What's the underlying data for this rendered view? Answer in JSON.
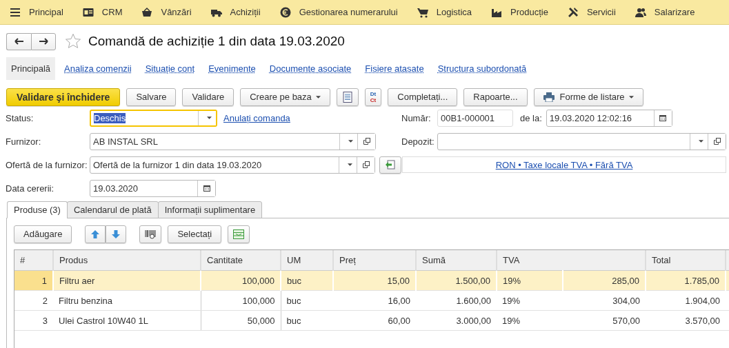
{
  "menu": [
    {
      "kind": "menu",
      "label": "Principal"
    },
    {
      "kind": "crm",
      "label": "CRM"
    },
    {
      "kind": "sales",
      "label": "Vânzări"
    },
    {
      "kind": "purchases",
      "label": "Achiziții"
    },
    {
      "kind": "money",
      "label": "Gestionarea numerarului"
    },
    {
      "kind": "logistics",
      "label": "Logistica"
    },
    {
      "kind": "production",
      "label": "Producție"
    },
    {
      "kind": "services",
      "label": "Servicii"
    },
    {
      "kind": "payroll",
      "label": "Salarizare"
    }
  ],
  "title": "Comandă de achiziție 1 din data 19.03.2020",
  "nav": [
    {
      "label": "Principală",
      "selected": true
    },
    {
      "label": "Analiza comenzii",
      "selected": false
    },
    {
      "label": "Situație cont",
      "selected": false
    },
    {
      "label": "Evenimente",
      "selected": false
    },
    {
      "label": "Documente asociate",
      "selected": false
    },
    {
      "label": "Fisiere atasate",
      "selected": false
    },
    {
      "label": "Structura subordonată",
      "selected": false
    }
  ],
  "toolbar": [
    {
      "kind": "primary",
      "label": "Validare şi închidere"
    },
    {
      "kind": "plain",
      "label": "Salvare"
    },
    {
      "kind": "plain",
      "label": "Validare"
    },
    {
      "kind": "menu",
      "label": "Creare pe baza"
    },
    {
      "kind": "doc"
    },
    {
      "kind": "dtct",
      "lines": [
        "Dt",
        "Ct"
      ]
    },
    {
      "kind": "plain",
      "label": "Completați..."
    },
    {
      "kind": "plain",
      "label": "Rapoarte..."
    },
    {
      "kind": "print-menu",
      "label": "Forme de listare"
    }
  ],
  "form": {
    "status": {
      "label": "Status:",
      "value": "Deschis",
      "focused": true,
      "link": "Anulați comanda"
    },
    "number": {
      "label": "Număr:",
      "value": "00B1-000001"
    },
    "date": {
      "label": "de la:",
      "value": "19.03.2020 12:02:16"
    },
    "supplier": {
      "label": "Furnizor:",
      "value": "AB INSTAL SRL"
    },
    "warehouse": {
      "label": "Depozit:"
    },
    "offer": {
      "label": "Ofertă de la furnizor:",
      "value": "Ofertă de la furnizor 1 din data 19.03.2020"
    },
    "currency_link": "RON • Taxe locale TVA • Fără TVA",
    "request_date": {
      "label": "Data cererii:",
      "value": "19.03.2020"
    }
  },
  "tabs": [
    {
      "label": "Produse (3)",
      "selected": true
    },
    {
      "label": "Calendarul de plată",
      "selected": false
    },
    {
      "label": "Informații suplimentare",
      "selected": false
    }
  ],
  "table_toolbar": [
    {
      "kind": "plain",
      "label": "Adăugare"
    },
    {
      "kind": "up"
    },
    {
      "kind": "down"
    },
    {
      "kind": "barcode"
    },
    {
      "kind": "plain",
      "label": "Selectați"
    },
    {
      "kind": "fill"
    }
  ],
  "table": {
    "columns": [
      "#",
      "Produs",
      "Cantitate",
      "UM",
      "Preț",
      "Sumă",
      "TVA",
      "Total"
    ],
    "rows": [
      {
        "num": "1",
        "product": "Filtru aer",
        "qty": "100,000",
        "um": "buc",
        "price": "15,00",
        "sum": "1.500,00",
        "vat_rate": "19%",
        "vat": "285,00",
        "total": "1.785,00",
        "selected": true
      },
      {
        "num": "2",
        "product": "Filtru benzina",
        "qty": "100,000",
        "um": "buc",
        "price": "16,00",
        "sum": "1.600,00",
        "vat_rate": "19%",
        "vat": "304,00",
        "total": "1.904,00",
        "selected": false
      },
      {
        "num": "3",
        "product": "Ulei Castrol 10W40 1L",
        "qty": "50,000",
        "um": "buc",
        "price": "60,00",
        "sum": "3.000,00",
        "vat_rate": "19%",
        "vat": "570,00",
        "total": "3.570,00",
        "selected": false
      }
    ]
  }
}
